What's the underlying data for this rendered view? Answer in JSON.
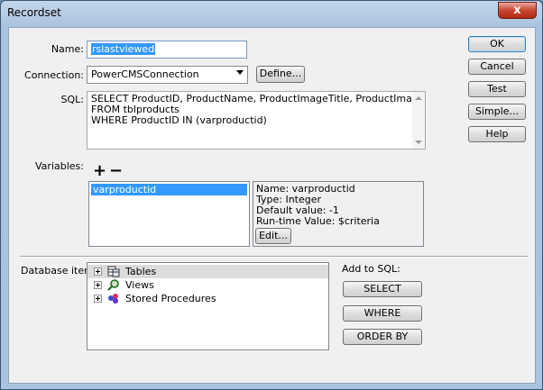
{
  "window": {
    "title": "Recordset",
    "close_label": "x"
  },
  "form": {
    "name_label": "Name:",
    "name_value": "rslastviewed",
    "connection_label": "Connection:",
    "connection_value": "PowerCMSConnection",
    "define_button": "Define...",
    "sql_label": "SQL:",
    "sql_lines": [
      "SELECT ProductID, ProductName, ProductImageTitle, ProductImage",
      "FROM tblproducts",
      "WHERE ProductID IN (varproductid)"
    ],
    "variables_label": "Variables:",
    "add_symbol": "+",
    "remove_symbol": "−",
    "variables": [
      "varproductid"
    ],
    "variable_details": [
      "Name: varproductid",
      "Type: Integer",
      "Default value: -1",
      "Run-time Value: $criteria"
    ],
    "edit_button": "Edit...",
    "database_items_label": "Database items:",
    "tree_items": [
      "Tables",
      "Views",
      "Stored Procedures"
    ],
    "add_to_sql_label": "Add to SQL:",
    "select_button": "SELECT",
    "where_button": "WHERE",
    "orderby_button": "ORDER BY"
  },
  "side_buttons": {
    "ok": "OK",
    "cancel": "Cancel",
    "test": "Test",
    "simple": "Simple...",
    "help": "Help"
  },
  "colors": {
    "selection": "#3399ff",
    "dialog_bg": "#f0f0f0",
    "title_bg": "#aac3de",
    "close_red": "#c9452f"
  }
}
